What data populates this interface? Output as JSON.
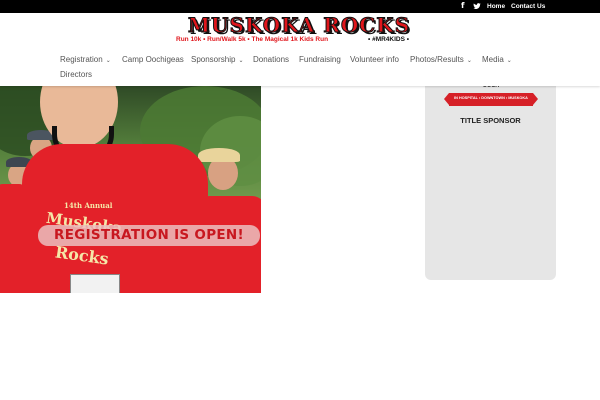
{
  "topbar": {
    "facebook_icon": "f",
    "twitter_icon": "𝕥",
    "home_label": "Home",
    "contact_label": "Contact Us"
  },
  "logo": {
    "title": "MUSKOKA ROCKS",
    "tagline": "Run 10k • Run/Walk 5k • The Magical 1k Kids Run",
    "hashtag": "• #MR4KIDS •"
  },
  "nav": {
    "items": [
      {
        "label": "Registration",
        "has_dropdown": true
      },
      {
        "label": "Camp Oochigeas",
        "has_dropdown": false
      },
      {
        "label": "Sponsorship",
        "has_dropdown": true
      },
      {
        "label": "Donations",
        "has_dropdown": false
      },
      {
        "label": "Fundraising",
        "has_dropdown": false
      },
      {
        "label": "Volunteer info",
        "has_dropdown": false
      },
      {
        "label": "Photos/Results",
        "has_dropdown": true
      },
      {
        "label": "Media",
        "has_dropdown": true
      },
      {
        "label": "Directors",
        "has_dropdown": false
      }
    ],
    "chevron": "⌄"
  },
  "hero": {
    "banner_text": "REGISTRATION IS OPEN!",
    "shirt_line1": "14th Annual",
    "shirt_line2": "Muskoka",
    "shirt_line3": "Rocks"
  },
  "sidebar": {
    "sponsor_ooch": "OOCH",
    "sponsor_ribbon": "IN HOSPITAL • DOWNTOWN • MUSKOKA",
    "sponsor_label": "TITLE SPONSOR"
  },
  "colors": {
    "brand_red": "#e0161c",
    "topbar": "#000000",
    "sidebar_bg": "#e6e6e6",
    "banner_text": "#c8171f"
  }
}
